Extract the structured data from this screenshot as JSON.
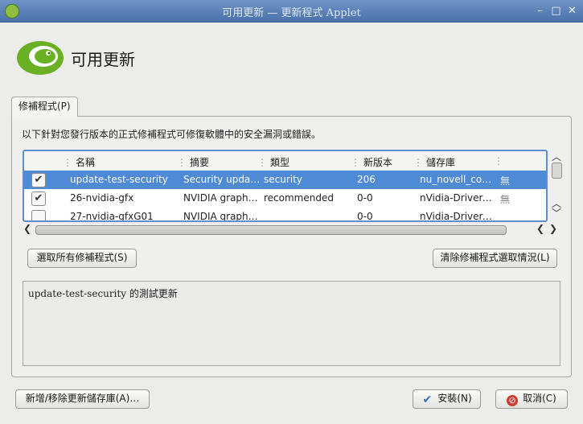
{
  "titlebar": {
    "title": "可用更新 — 更新程式 Applet",
    "minimize": "–",
    "maximize": "□",
    "close": "✕"
  },
  "header": {
    "title": "可用更新"
  },
  "tab": {
    "label": "修補程式(P)"
  },
  "panel": {
    "description": "以下針對您發行版本的正式修補程式可修復軟體中的安全漏洞或錯誤。"
  },
  "table": {
    "columns": [
      "名稱",
      "摘要",
      "類型",
      "新版本",
      "儲存庫"
    ],
    "rows": [
      {
        "checked": "✔",
        "name": "update-test-security",
        "summary": "Security upda…",
        "type": "security",
        "version": "206",
        "repo": "nu_novell_co…",
        "extra": "無"
      },
      {
        "checked": "✔",
        "name": "26-nvidia-gfx",
        "summary": "NVIDIA graph…",
        "type": "recommended",
        "version": "0-0",
        "repo": "nVidia-Driver-…",
        "extra": "無"
      },
      {
        "checked": "",
        "name": "27-nvidia-gfxG01",
        "summary": "NVIDIA graph…",
        "type": "",
        "version": "0-0",
        "repo": "nVidia-Driver-…",
        "extra": ""
      }
    ]
  },
  "buttons": {
    "select_all": "選取所有修補程式(S)",
    "clear_selection": "清除修補程式選取情況(L)",
    "manage_repos": "新增/移除更新儲存庫(A)…",
    "install": "安裝(N)",
    "cancel": "取消(C)"
  },
  "details": {
    "text": "update-test-security 的測試更新"
  },
  "colors": {
    "selection": "#4f8ad6",
    "titlebar": "#5a7fb5",
    "logo_green": "#6ab023"
  },
  "icons": [
    "opensuse-logo-icon",
    "check-icon",
    "scroll-up-icon",
    "scroll-down-icon",
    "scroll-left-icon",
    "scroll-right-icon",
    "install-check-icon",
    "cancel-icon"
  ]
}
